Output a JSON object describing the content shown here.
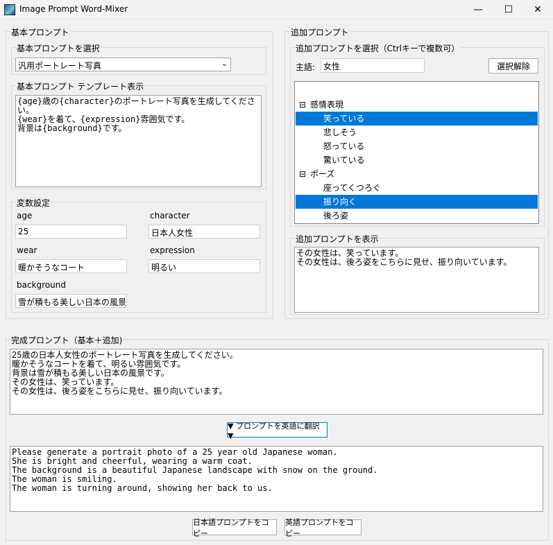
{
  "window": {
    "title": "Image Prompt Word-Mixer",
    "minimize": "—",
    "maximize": "☐",
    "close": "✕"
  },
  "basic": {
    "group_label": "基本プロンプト",
    "select_label": "基本プロンプトを選択",
    "select_value": "汎用ポートレート写真",
    "template_label": "基本プロンプト テンプレート表示",
    "template_text": "{age}歳の{character}のポートレート写真を生成してください。\n{wear}を着て、{expression}雰囲気です。\n背景は{background}です。",
    "vars_label": "変数設定",
    "vars": {
      "age_label": "age",
      "age_value": "25",
      "character_label": "character",
      "character_value": "日本人女性",
      "wear_label": "wear",
      "wear_value": "暖かそうなコート",
      "expression_label": "expression",
      "expression_value": "明るい",
      "background_label": "background",
      "background_value": "雪が積もる美しい日本の風景"
    }
  },
  "additional": {
    "group_label": "追加プロンプト",
    "select_label": "追加プロンプトを選択（Ctrlキーで複数可）",
    "subject_label": "主語:",
    "subject_value": "女性",
    "clear_button": "選択解除",
    "tree": [
      {
        "text": "感情表現",
        "type": "category",
        "expander": "⊟"
      },
      {
        "text": "笑っている",
        "type": "item",
        "selected": true
      },
      {
        "text": "悲しそう",
        "type": "item",
        "selected": false
      },
      {
        "text": "怒っている",
        "type": "item",
        "selected": false
      },
      {
        "text": "驚いている",
        "type": "item",
        "selected": false
      },
      {
        "text": "ポーズ",
        "type": "category",
        "expander": "⊟"
      },
      {
        "text": "座ってくつろぐ",
        "type": "item",
        "selected": false
      },
      {
        "text": "振り向く",
        "type": "item",
        "selected": true
      },
      {
        "text": "後ろ姿",
        "type": "item",
        "selected": false
      }
    ],
    "display_label": "追加プロンプトを表示",
    "display_text": "その女性は、笑っています。\nその女性は、後ろ姿をこちらに見せ、振り向いています。"
  },
  "complete": {
    "group_label": "完成プロンプト（基本＋追加)",
    "japanese_text": "25歳の日本人女性のポートレート写真を生成してください。\n暖かそうなコートを着て、明るい雰囲気です。\n背景は雪が積もる美しい日本の風景です。\nその女性は、笑っています。\nその女性は、後ろ姿をこちらに見せ、振り向いています。",
    "translate_button": "▼ プロンプトを英語に翻訳 ▼",
    "english_text": "Please generate a portrait photo of a 25 year old Japanese woman.\nShe is bright and cheerful, wearing a warm coat.\nThe background is a beautiful Japanese landscape with snow on the ground.\nThe woman is smiling.\nThe woman is turning around, showing her back to us.",
    "copy_japanese_button": "日本語プロンプトをコピー",
    "copy_english_button": "英語プロンプトをコピー"
  },
  "colors": {
    "selection": "#0078d7",
    "window_bg": "#f0f0f0"
  }
}
